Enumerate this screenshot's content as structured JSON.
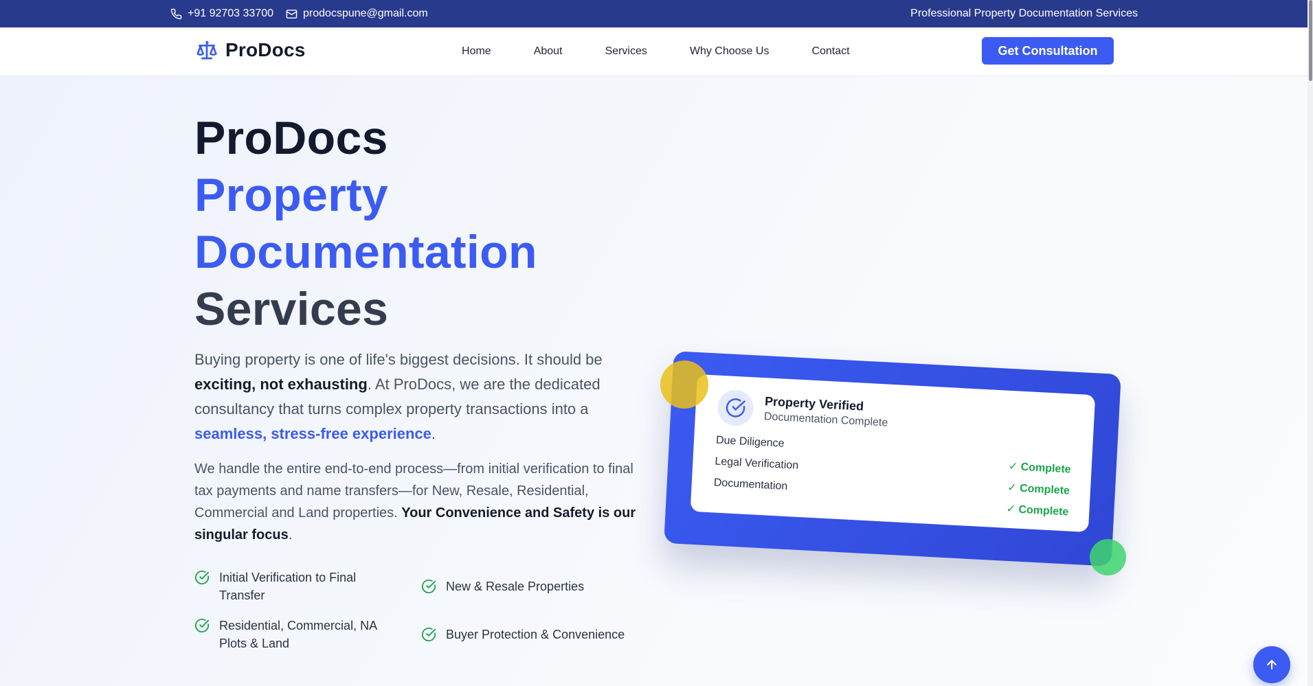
{
  "topbar": {
    "phone": "+91 92703 33700",
    "email": "prodocspune@gmail.com",
    "tagline": "Professional Property Documentation Services",
    "icons": [
      "phone-icon",
      "mail-icon"
    ]
  },
  "nav": {
    "brand": "ProDocs",
    "links": [
      "Home",
      "About",
      "Services",
      "Why Choose Us",
      "Contact"
    ],
    "cta": "Get Consultation"
  },
  "hero": {
    "title_1": "ProDocs",
    "title_2a": "Property",
    "title_2b": "Documentation",
    "title_3": "Services",
    "p1_a": "Buying property is one of life's biggest decisions. It should be ",
    "p1_b": "exciting, not exhausting",
    "p1_c": ". At ProDocs, we are the dedicated consultancy that turns complex property transactions into a ",
    "p1_d": "seamless, stress-free experience",
    "p1_e": ".",
    "p2_a": "We handle the entire end-to-end process—from initial verification to final tax payments and name transfers—for New, Resale, Residential, Commercial and Land properties. ",
    "p2_b": "Your Convenience and Safety is our singular focus",
    "p2_c": ".",
    "features": [
      "Initial Verification to Final Transfer",
      "New & Resale Properties",
      "Residential, Commercial, NA Plots & Land",
      "Buyer Protection & Convenience"
    ]
  },
  "card": {
    "title": "Property Verified",
    "subtitle": "Documentation Complete",
    "rows": [
      {
        "label": "Due Diligence",
        "status": "✓ Complete"
      },
      {
        "label": "Legal Verification",
        "status": "✓ Complete"
      },
      {
        "label": "Documentation",
        "status": "✓ Complete"
      }
    ]
  },
  "colors": {
    "accent": "#3b5bf2",
    "topbar": "#283a8c",
    "success": "#1aa64a",
    "yellow": "#eac01a",
    "green": "#40d66d"
  }
}
